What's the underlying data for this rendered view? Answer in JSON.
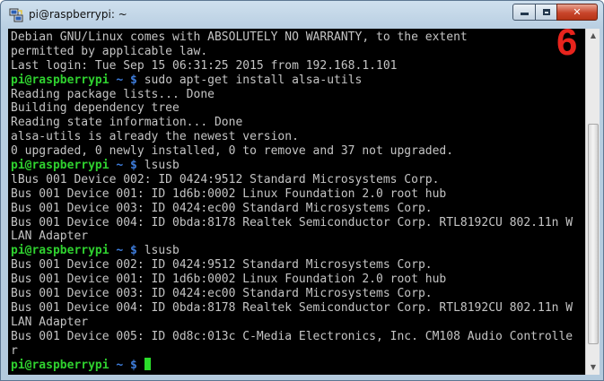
{
  "window": {
    "title": "pi@raspberrypi: ~",
    "controls": {
      "minimize": "minimize",
      "maximize": "maximize",
      "close": "✕"
    }
  },
  "overlay": {
    "step_number": "6"
  },
  "prompt": {
    "user_host": "pi@raspberrypi",
    "path": " ~ $ "
  },
  "terminal": {
    "lines": [
      {
        "type": "text",
        "text": "Debian GNU/Linux comes with ABSOLUTELY NO WARRANTY, to the extent"
      },
      {
        "type": "text",
        "text": "permitted by applicable law."
      },
      {
        "type": "text",
        "text": "Last login: Tue Sep 15 06:31:25 2015 from 192.168.1.101"
      },
      {
        "type": "prompt",
        "command": "sudo apt-get install alsa-utils"
      },
      {
        "type": "text",
        "text": "Reading package lists... Done"
      },
      {
        "type": "text",
        "text": "Building dependency tree"
      },
      {
        "type": "text",
        "text": "Reading state information... Done"
      },
      {
        "type": "text",
        "text": "alsa-utils is already the newest version."
      },
      {
        "type": "text",
        "text": "0 upgraded, 0 newly installed, 0 to remove and 37 not upgraded."
      },
      {
        "type": "prompt",
        "command": "lsusb"
      },
      {
        "type": "text",
        "text": "lBus 001 Device 002: ID 0424:9512 Standard Microsystems Corp."
      },
      {
        "type": "text",
        "text": "Bus 001 Device 001: ID 1d6b:0002 Linux Foundation 2.0 root hub"
      },
      {
        "type": "text",
        "text": "Bus 001 Device 003: ID 0424:ec00 Standard Microsystems Corp."
      },
      {
        "type": "text",
        "text": "Bus 001 Device 004: ID 0bda:8178 Realtek Semiconductor Corp. RTL8192CU 802.11n W"
      },
      {
        "type": "text",
        "text": "LAN Adapter"
      },
      {
        "type": "prompt",
        "command": "lsusb"
      },
      {
        "type": "text",
        "text": "Bus 001 Device 002: ID 0424:9512 Standard Microsystems Corp."
      },
      {
        "type": "text",
        "text": "Bus 001 Device 001: ID 1d6b:0002 Linux Foundation 2.0 root hub"
      },
      {
        "type": "text",
        "text": "Bus 001 Device 003: ID 0424:ec00 Standard Microsystems Corp."
      },
      {
        "type": "text",
        "text": "Bus 001 Device 004: ID 0bda:8178 Realtek Semiconductor Corp. RTL8192CU 802.11n W"
      },
      {
        "type": "text",
        "text": "LAN Adapter"
      },
      {
        "type": "text",
        "text": "Bus 001 Device 005: ID 0d8c:013c C-Media Electronics, Inc. CM108 Audio Controlle"
      },
      {
        "type": "text",
        "text": "r"
      },
      {
        "type": "prompt",
        "command": "",
        "cursor": true
      }
    ]
  },
  "colors": {
    "terminal_bg": "#000000",
    "terminal_fg": "#c4c4c4",
    "prompt_user": "#2fd12f",
    "prompt_path": "#3d7bd9",
    "step_label": "#e8241d"
  }
}
